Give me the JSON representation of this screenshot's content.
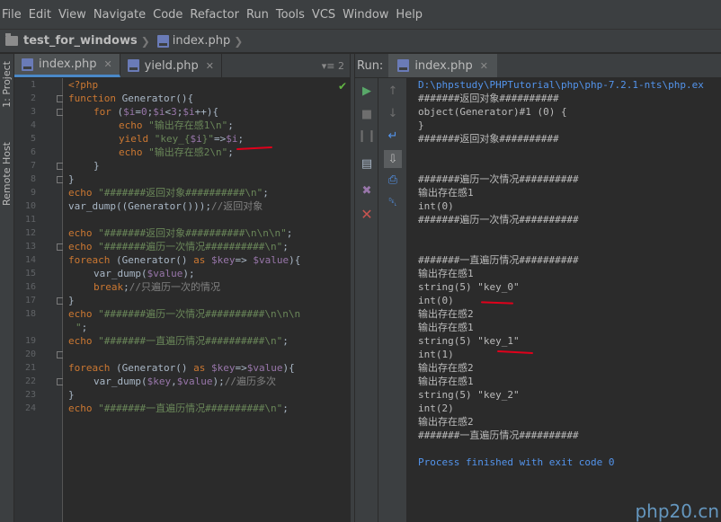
{
  "menu": [
    "File",
    "Edit",
    "View",
    "Navigate",
    "Code",
    "Refactor",
    "Run",
    "Tools",
    "VCS",
    "Window",
    "Help"
  ],
  "nav": {
    "project": "test_for_windows",
    "file": "index.php"
  },
  "left_stripe": {
    "project": "1: Project",
    "remote": "Remote Host"
  },
  "editor_tabs": [
    {
      "label": "index.php",
      "active": true
    },
    {
      "label": "yield.php",
      "active": false
    }
  ],
  "tab_tools": "▾≡ 2",
  "code_lines": [
    "1",
    "2",
    "3",
    "4",
    "5",
    "6",
    "7",
    "8",
    "9",
    "10",
    "11",
    "12",
    "13",
    "14",
    "15",
    "16",
    "17",
    "18",
    "",
    "19",
    "20",
    "21",
    "22",
    "23",
    "24"
  ],
  "run": {
    "label": "Run:",
    "tab": "index.php"
  },
  "console_lines": [
    "D:\\phpstudy\\PHPTutorial\\php\\php-7.2.1-nts\\php.ex",
    "#######返回对象##########",
    "object(Generator)#1 (0) {",
    "}",
    "#######返回对象##########",
    "",
    "",
    "#######遍历一次情况##########",
    "输出存在感1",
    "int(0)",
    "#######遍历一次情况##########",
    "",
    "",
    "#######一直遍历情况##########",
    "输出存在感1",
    "string(5) \"key_0\"",
    "int(0)",
    "输出存在感2",
    "输出存在感1",
    "string(5) \"key_1\"",
    "int(1)",
    "输出存在感2",
    "输出存在感1",
    "string(5) \"key_2\"",
    "int(2)",
    "输出存在感2",
    "#######一直遍历情况##########",
    "",
    "Process finished with exit code 0"
  ],
  "watermark": "php20.cn"
}
